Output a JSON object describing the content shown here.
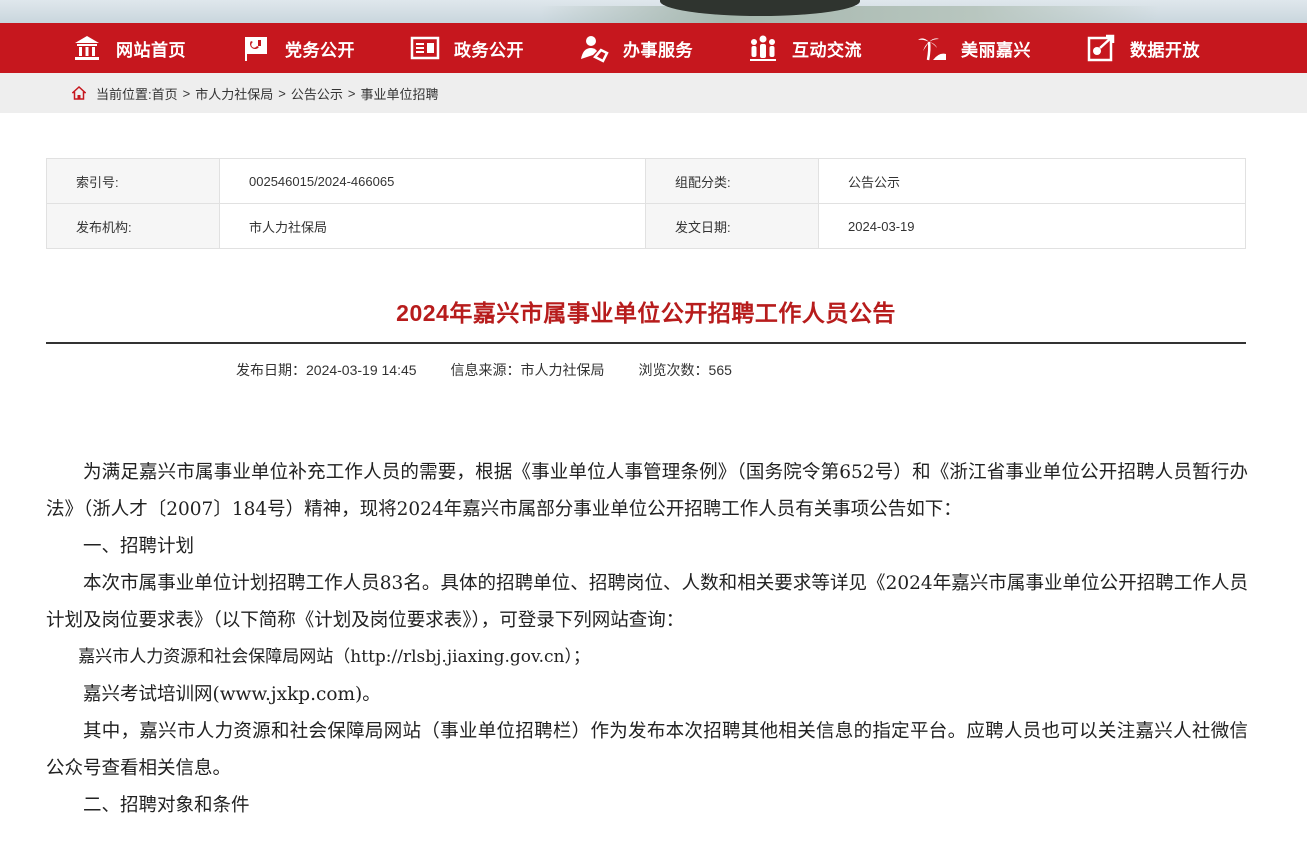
{
  "nav": {
    "items": [
      {
        "label": "网站首页",
        "icon": "home-icon"
      },
      {
        "label": "党务公开",
        "icon": "party-flag-icon"
      },
      {
        "label": "政务公开",
        "icon": "document-icon"
      },
      {
        "label": "办事服务",
        "icon": "service-hand-icon"
      },
      {
        "label": "互动交流",
        "icon": "people-icon"
      },
      {
        "label": "美丽嘉兴",
        "icon": "palm-tree-icon"
      },
      {
        "label": "数据开放",
        "icon": "data-share-icon"
      }
    ]
  },
  "breadcrumb": {
    "prefix": "当前位置:",
    "items": [
      "首页",
      "市人力社保局",
      "公告公示",
      "事业单位招聘"
    ],
    "separator": ">"
  },
  "meta": {
    "index_label": "索引号:",
    "index_value": "002546015/2024-466065",
    "category_label": "组配分类:",
    "category_value": "公告公示",
    "publisher_label": "发布机构:",
    "publisher_value": "市人力社保局",
    "date_label": "发文日期:",
    "date_value": "2024-03-19"
  },
  "article": {
    "title": "2024年嘉兴市属事业单位公开招聘工作人员公告",
    "publish_date": "发布日期：2024-03-19 14:45",
    "source": "信息来源：市人力社保局",
    "views": "浏览次数：565",
    "paragraphs": [
      "为满足嘉兴市属事业单位补充工作人员的需要，根据《事业单位人事管理条例》（国务院令第652号）和《浙江省事业单位公开招聘人员暂行办法》（浙人才〔2007〕184号）精神，现将2024年嘉兴市属部分事业单位公开招聘工作人员有关事项公告如下：",
      "一、招聘计划",
      "本次市属事业单位计划招聘工作人员83名。具体的招聘单位、招聘岗位、人数和相关要求等详见《2024年嘉兴市属事业单位公开招聘工作人员计划及岗位要求表》（以下简称《计划及岗位要求表》），可登录下列网站查询：",
      "嘉兴市人力资源和社会保障局网站（http://rlsbj.jiaxing.gov.cn）；",
      "嘉兴考试培训网(www.jxkp.com)。",
      "其中，嘉兴市人力资源和社会保障局网站（事业单位招聘栏）作为发布本次招聘其他相关信息的指定平台。应聘人员也可以关注嘉兴人社微信公众号查看相关信息。",
      "二、招聘对象和条件"
    ]
  },
  "colors": {
    "nav_bg": "#c6171e",
    "title_red": "#b71c1c"
  }
}
